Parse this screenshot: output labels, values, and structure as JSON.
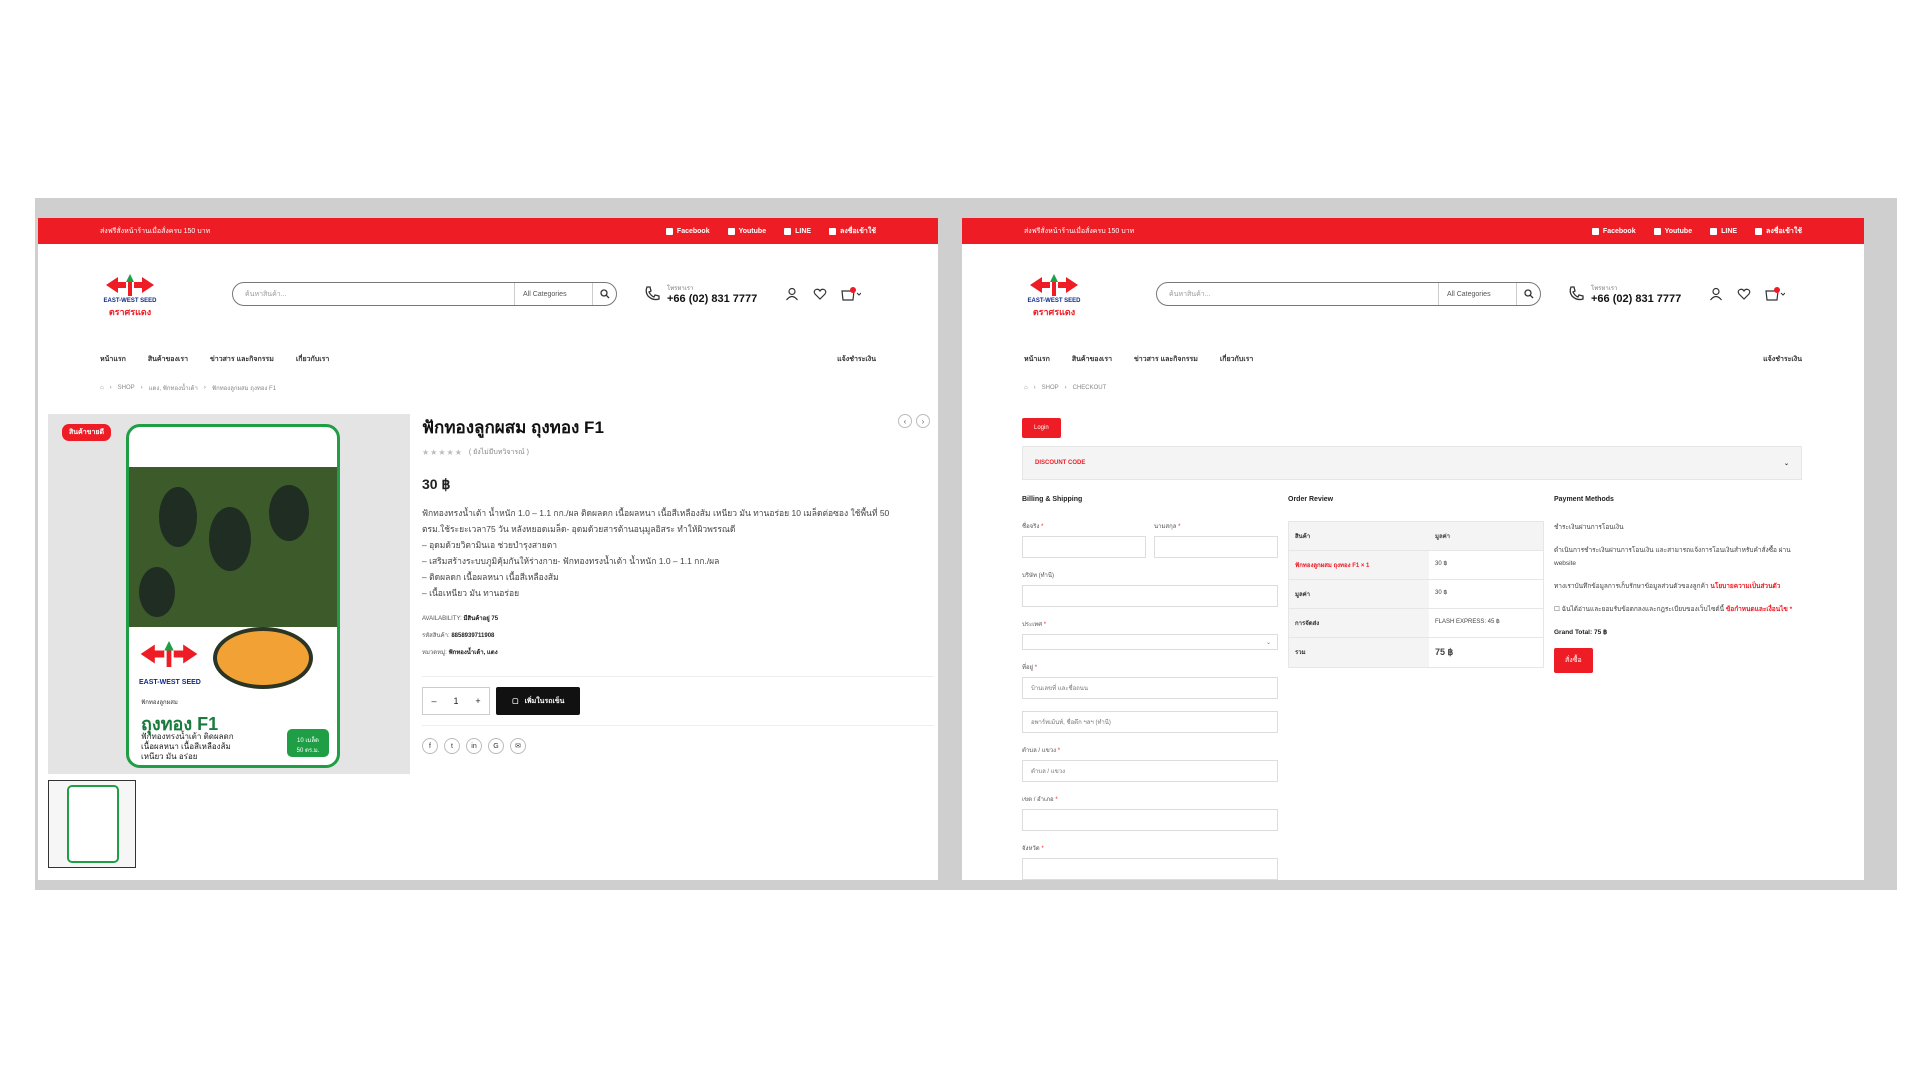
{
  "header": {
    "promo": "ส่งฟรีสั่งหน้าร้านเมื่อสั่งครบ 150 บาท",
    "links": [
      "Facebook",
      "Youtube",
      "LINE",
      "ลงชื่อเข้าใช้"
    ],
    "logo_top": "EAST-WEST SEED",
    "logo_bottom": "ตราศรแดง",
    "search_placeholder": "ค้นหาสินค้า...",
    "categories": "All Categories",
    "phone_label": "โทรหาเรา",
    "phone": "+66 (02) 831 7777",
    "cart_count": "0"
  },
  "nav": {
    "items": [
      "หน้าแรก",
      "สินค้าของเรา",
      "ข่าวสาร และกิจกรรม",
      "เกี่ยวกับเรา"
    ],
    "right": "แจ้งชำระเงิน"
  },
  "product_page": {
    "breadcrumb": [
      "SHOP",
      "แตง, ฟักทองน้ำเต้า",
      "ฟักทองลูกผสม ถุงทอง F1"
    ],
    "badge": "สินค้าขายดี",
    "title": "ฟักทองลูกผสม ถุงทอง F1",
    "reviews": "( ยังไม่มีบทวิจารณ์ )",
    "price": "30 ฿",
    "desc_lines": [
      "ฟักทองทรงน้ำเต้า น้ำหนัก 1.0 – 1.1 กก./ผล ติดผลดก เนื้อผลหนา เนื้อสีเหลืองส้ม เหนียว มัน ทานอร่อย 10 เมล็ดต่อซอง ใช้พื้นที่ 50",
      "ตรม.ใช้ระยะเวลา75 วัน หลังหยอดเมล็ด- อุดมด้วยสารต้านอนุมูลอิสระ ทำให้ผิวพรรณดี",
      "– อุดมด้วยวิตามินเอ ช่วยบำรุงสายตา",
      "– เสริมสร้างระบบภูมิคุ้มกันให้ร่างกาย- ฟักทองทรงน้ำเต้า น้ำหนัก 1.0 – 1.1 กก./ผล",
      "– ติดผลดก เนื้อผลหนา เนื้อสีเหลืองส้ม",
      "– เนื้อเหนียว มัน ทานอร่อย"
    ],
    "availability_label": "AVAILABILITY:",
    "availability": "มีสินค้าอยู่ 75",
    "sku_label": "รหัสสินค้า:",
    "sku": "8858939711908",
    "category_label": "หมวดหมู่:",
    "category": "ฟักทองน้ำเต้า, แตง",
    "qty": "1",
    "add_to_cart": "เพิ่มในรถเข็น",
    "pack_name": "ถุงทอง F1",
    "pack_brand": "EAST-WEST SEED",
    "pack_small": "ฟักทองลูกผสม",
    "pack_tagline": [
      "ฟักทองทรงน้ำเต้า ติดผลดก",
      "เนื้อผลหนา เนื้อสีเหลืองส้ม",
      "เหนียว มัน อร่อย"
    ],
    "pack_corner": [
      "10 เมล็ด",
      "50 ตร.ม."
    ]
  },
  "checkout_page": {
    "breadcrumb": [
      "SHOP",
      "CHECKOUT"
    ],
    "login": "Login",
    "discount": "DISCOUNT CODE",
    "billing_title": "Billing & Shipping",
    "fields": {
      "first_name": "ชื่อจริง",
      "last_name": "นามสกุล",
      "company": "บริษัท (ทำนี)",
      "country": "ประเทศ",
      "address": "ที่อยู่",
      "address_ph1": "บ้านเลขที่ และชื่อถนน",
      "address_ph2": "อพาร์ทเม้นท์, ชื่อตึก ฯลฯ (ทำนี)",
      "subdistrict": "ตำบล / แขวง",
      "subdistrict_ph": "ตำบล / แขวง",
      "district": "เขต / อำเภอ",
      "province": "จังหวัด"
    },
    "order_title": "Order Review",
    "order_rows": [
      {
        "c1": "สินค้า",
        "c2": "มูลค่า"
      },
      {
        "c1": "ฟักทองลูกผสม ถุงทอง F1 × 1",
        "c2": "30 ฿"
      },
      {
        "c1": "มูลค่า",
        "c2": "30 ฿"
      },
      {
        "c1": "การจัดส่ง",
        "c2": "FLASH EXPRESS: 45 ฿"
      },
      {
        "c1": "รวม",
        "c2": "75 ฿"
      }
    ],
    "payment_title": "Payment Methods",
    "pay_method": "ชำระเงินผ่านการโอนเงิน",
    "pay_desc": "ดำเนินการชำระเงินผ่านการโอนเงิน และสามารถแจ้งการโอนเงินสำหรับคำสั่งซื้อ ผ่าน website",
    "privacy": "ทางเราบันทึกข้อมูลการเก็บรักษาข้อมูลส่วนตัวของลูกค้า",
    "privacy_link": "นโยบายความเป็นส่วนตัว",
    "terms": "ฉันได้อ่านและยอมรับข้อตกลงและกฎระเบียบของเว็บไซต์นี้",
    "terms_link": "ข้อกำหนดและเงื่อนไข",
    "grand_total_label": "Grand Total:",
    "grand_total": "75 ฿",
    "place_order": "สั่งซื้อ"
  }
}
